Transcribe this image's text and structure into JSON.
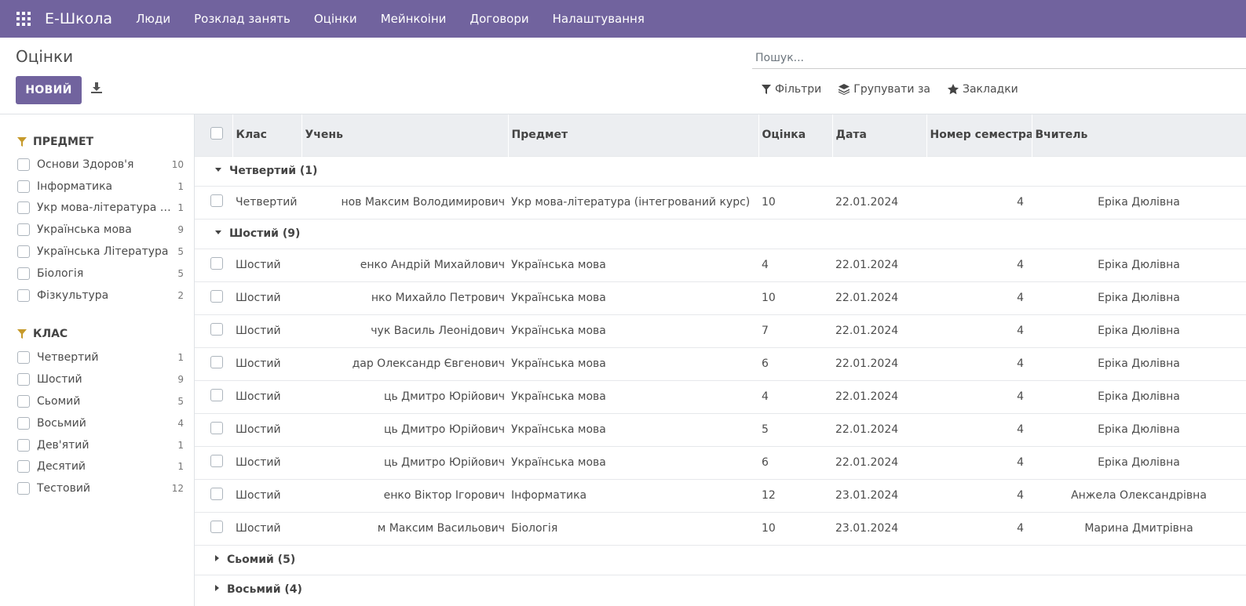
{
  "navbar": {
    "brand": "Е-Школа",
    "menu": [
      "Люди",
      "Розклад занять",
      "Оцінки",
      "Мейнкоіни",
      "Договори",
      "Налаштування"
    ]
  },
  "control_panel": {
    "title": "Оцінки",
    "new_button": "НОВИЙ",
    "search_placeholder": "Пошук...",
    "filters_label": "Фільтри",
    "group_by_label": "Групувати за",
    "favorites_label": "Закладки"
  },
  "sidebar": {
    "subject_header": "ПРЕДМЕТ",
    "subjects": [
      {
        "label": "Основи Здоров'я",
        "count": "10"
      },
      {
        "label": "Інформатика",
        "count": "1"
      },
      {
        "label": "Укр мова-література (інтегрований курс)",
        "count": "1"
      },
      {
        "label": "Українська мова",
        "count": "9"
      },
      {
        "label": "Українська Література",
        "count": "5"
      },
      {
        "label": "Біологія",
        "count": "5"
      },
      {
        "label": "Фізкультура",
        "count": "2"
      }
    ],
    "class_header": "КЛАС",
    "classes": [
      {
        "label": "Четвертий",
        "count": "1"
      },
      {
        "label": "Шостий",
        "count": "9"
      },
      {
        "label": "Сьомий",
        "count": "5"
      },
      {
        "label": "Восьмий",
        "count": "4"
      },
      {
        "label": "Дев'ятий",
        "count": "1"
      },
      {
        "label": "Десятий",
        "count": "1"
      },
      {
        "label": "Тестовий",
        "count": "12"
      }
    ]
  },
  "table": {
    "columns": [
      "Клас",
      "Учень",
      "Предмет",
      "Оцінка",
      "Дата",
      "Номер семестра",
      "Вчитель"
    ],
    "groups": [
      {
        "label": "Четвертий (1)",
        "expanded": true
      },
      {
        "label": "Шостий (9)",
        "expanded": true
      },
      {
        "label": "Сьомий (5)",
        "expanded": false
      },
      {
        "label": "Восьмий (4)",
        "expanded": false
      }
    ],
    "group4_rows": [
      {
        "class": "Четвертий",
        "student": "нов Максим Володимирович",
        "subject": "Укр мова-література (інтегрований курс)",
        "grade": "10",
        "date": "22.01.2024",
        "semester": "4",
        "teacher": "Еріка Дюлівна"
      }
    ],
    "group6_rows": [
      {
        "class": "Шостий",
        "student": "енко Андрій Михайлович",
        "subject": "Українська мова",
        "grade": "4",
        "date": "22.01.2024",
        "semester": "4",
        "teacher": "Еріка Дюлівна"
      },
      {
        "class": "Шостий",
        "student": "нко Михайло Петрович",
        "subject": "Українська мова",
        "grade": "10",
        "date": "22.01.2024",
        "semester": "4",
        "teacher": "Еріка Дюлівна"
      },
      {
        "class": "Шостий",
        "student": "чук Василь Леонідович",
        "subject": "Українська мова",
        "grade": "7",
        "date": "22.01.2024",
        "semester": "4",
        "teacher": "Еріка Дюлівна"
      },
      {
        "class": "Шостий",
        "student": "дар Олександр Євгенович",
        "subject": "Українська мова",
        "grade": "6",
        "date": "22.01.2024",
        "semester": "4",
        "teacher": "Еріка Дюлівна"
      },
      {
        "class": "Шостий",
        "student": "ць Дмитро Юрійович",
        "subject": "Українська мова",
        "grade": "4",
        "date": "22.01.2024",
        "semester": "4",
        "teacher": "Еріка Дюлівна"
      },
      {
        "class": "Шостий",
        "student": "ць Дмитро Юрійович",
        "subject": "Українська мова",
        "grade": "5",
        "date": "22.01.2024",
        "semester": "4",
        "teacher": "Еріка Дюлівна"
      },
      {
        "class": "Шостий",
        "student": "ць Дмитро Юрійович",
        "subject": "Українська мова",
        "grade": "6",
        "date": "22.01.2024",
        "semester": "4",
        "teacher": "Еріка Дюлівна"
      },
      {
        "class": "Шостий",
        "student": "енко Віктор Ігорович",
        "subject": "Інформатика",
        "grade": "12",
        "date": "23.01.2024",
        "semester": "4",
        "teacher": "Анжела Олександрівна"
      },
      {
        "class": "Шостий",
        "student": "м Максим Васильович",
        "subject": "Біологія",
        "grade": "10",
        "date": "23.01.2024",
        "semester": "4",
        "teacher": "Марина Дмитрівна"
      }
    ]
  },
  "colors": {
    "brand": "#71639e",
    "header_bg": "#eceef1"
  }
}
